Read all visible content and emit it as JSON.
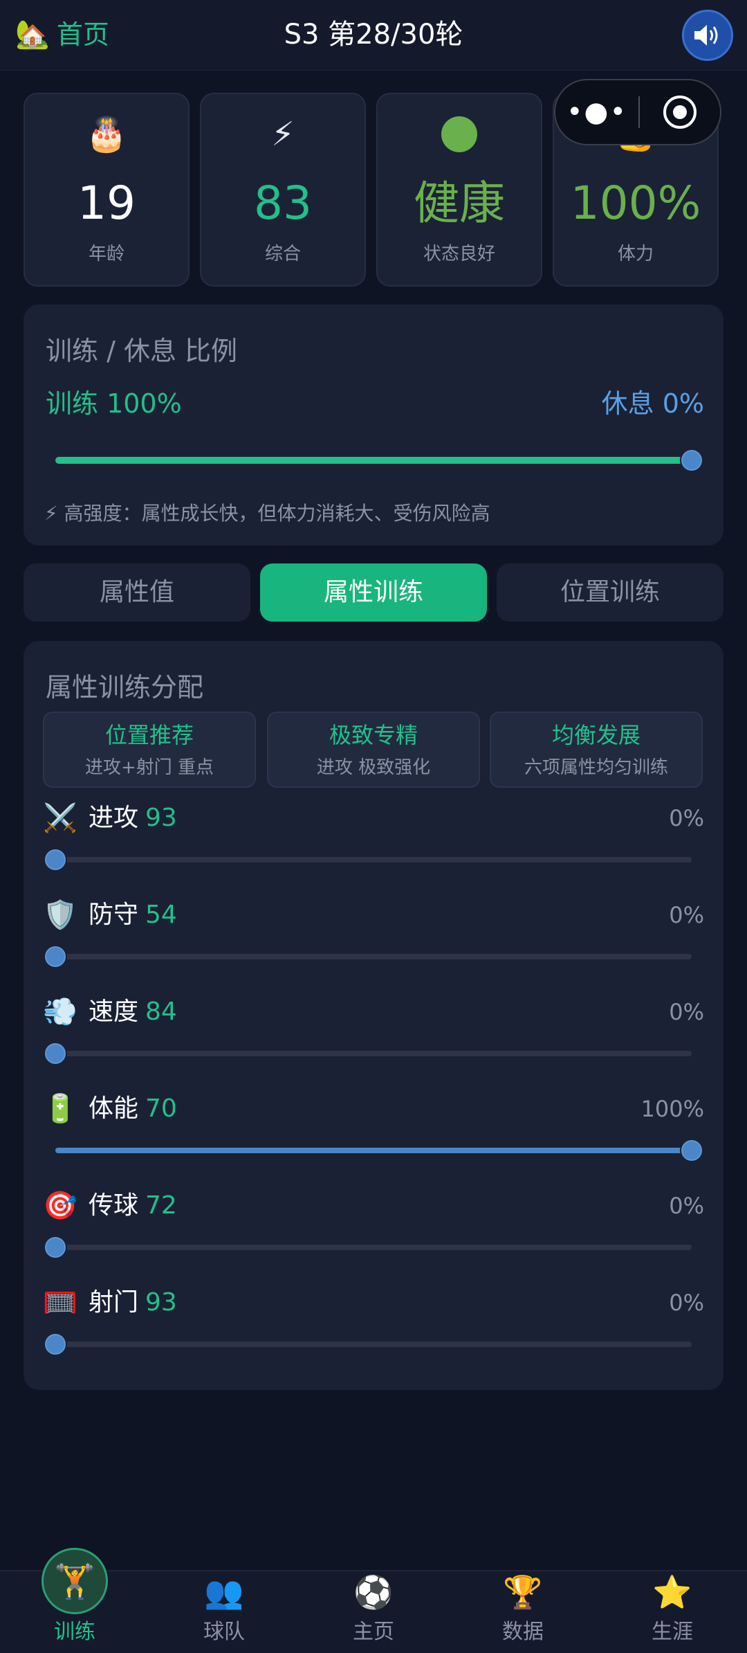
{
  "header": {
    "home_icon": "house-emoji",
    "home_label": "首页",
    "title": "S3 第28/30轮",
    "sound_icon": "speaker-icon"
  },
  "stats": [
    {
      "emoji": "🎂",
      "value": "19",
      "caption": "年龄",
      "color": "#ffffff"
    },
    {
      "emoji": "⚡",
      "value": "83",
      "caption": "综合",
      "color": "#22c08a"
    },
    {
      "emoji": "",
      "value": "健康",
      "caption": "状态良好",
      "color": "#6ab04c"
    },
    {
      "emoji": "💪",
      "value": "100%",
      "caption": "体力",
      "color": "#6ab04c"
    }
  ],
  "ratio": {
    "title": "训练 / 休息 比例",
    "train_label": "训练 100%",
    "rest_label": "休息 0%",
    "train_fraction": 1.0,
    "hint": "⚡ 高强度：属性成长快，但体力消耗大、受伤风险高"
  },
  "tabs": [
    {
      "label": "属性值",
      "active": false
    },
    {
      "label": "属性训练",
      "active": true
    },
    {
      "label": "位置训练",
      "active": false
    }
  ],
  "allocation": {
    "title": "属性训练分配",
    "presets": [
      {
        "name": "位置推荐",
        "desc": "进攻+射门 重点"
      },
      {
        "name": "极致专精",
        "desc": "进攻 极致强化"
      },
      {
        "name": "均衡发展",
        "desc": "六项属性均匀训练"
      }
    ],
    "attributes": [
      {
        "icon": "⚔️",
        "name": "进攻",
        "score": "93",
        "pct": "0%",
        "fraction": 0
      },
      {
        "icon": "🛡️",
        "name": "防守",
        "score": "54",
        "pct": "0%",
        "fraction": 0
      },
      {
        "icon": "💨",
        "name": "速度",
        "score": "84",
        "pct": "0%",
        "fraction": 0
      },
      {
        "icon": "🔋",
        "name": "体能",
        "score": "70",
        "pct": "100%",
        "fraction": 1
      },
      {
        "icon": "🎯",
        "name": "传球",
        "score": "72",
        "pct": "0%",
        "fraction": 0
      },
      {
        "icon": "🥅",
        "name": "射门",
        "score": "93",
        "pct": "0%",
        "fraction": 0
      }
    ]
  },
  "nav": [
    {
      "icon": "🏋️",
      "label": "训练",
      "active": true
    },
    {
      "icon": "👥",
      "label": "球队",
      "active": false
    },
    {
      "icon": "⚽",
      "label": "主页",
      "active": false
    },
    {
      "icon": "🏆",
      "label": "数据",
      "active": false
    },
    {
      "icon": "⭐",
      "label": "生涯",
      "active": false
    }
  ],
  "colors": {
    "accent_green": "#22c08a",
    "rest_blue": "#5aa0e6",
    "slider_blue": "#4a86c8"
  }
}
